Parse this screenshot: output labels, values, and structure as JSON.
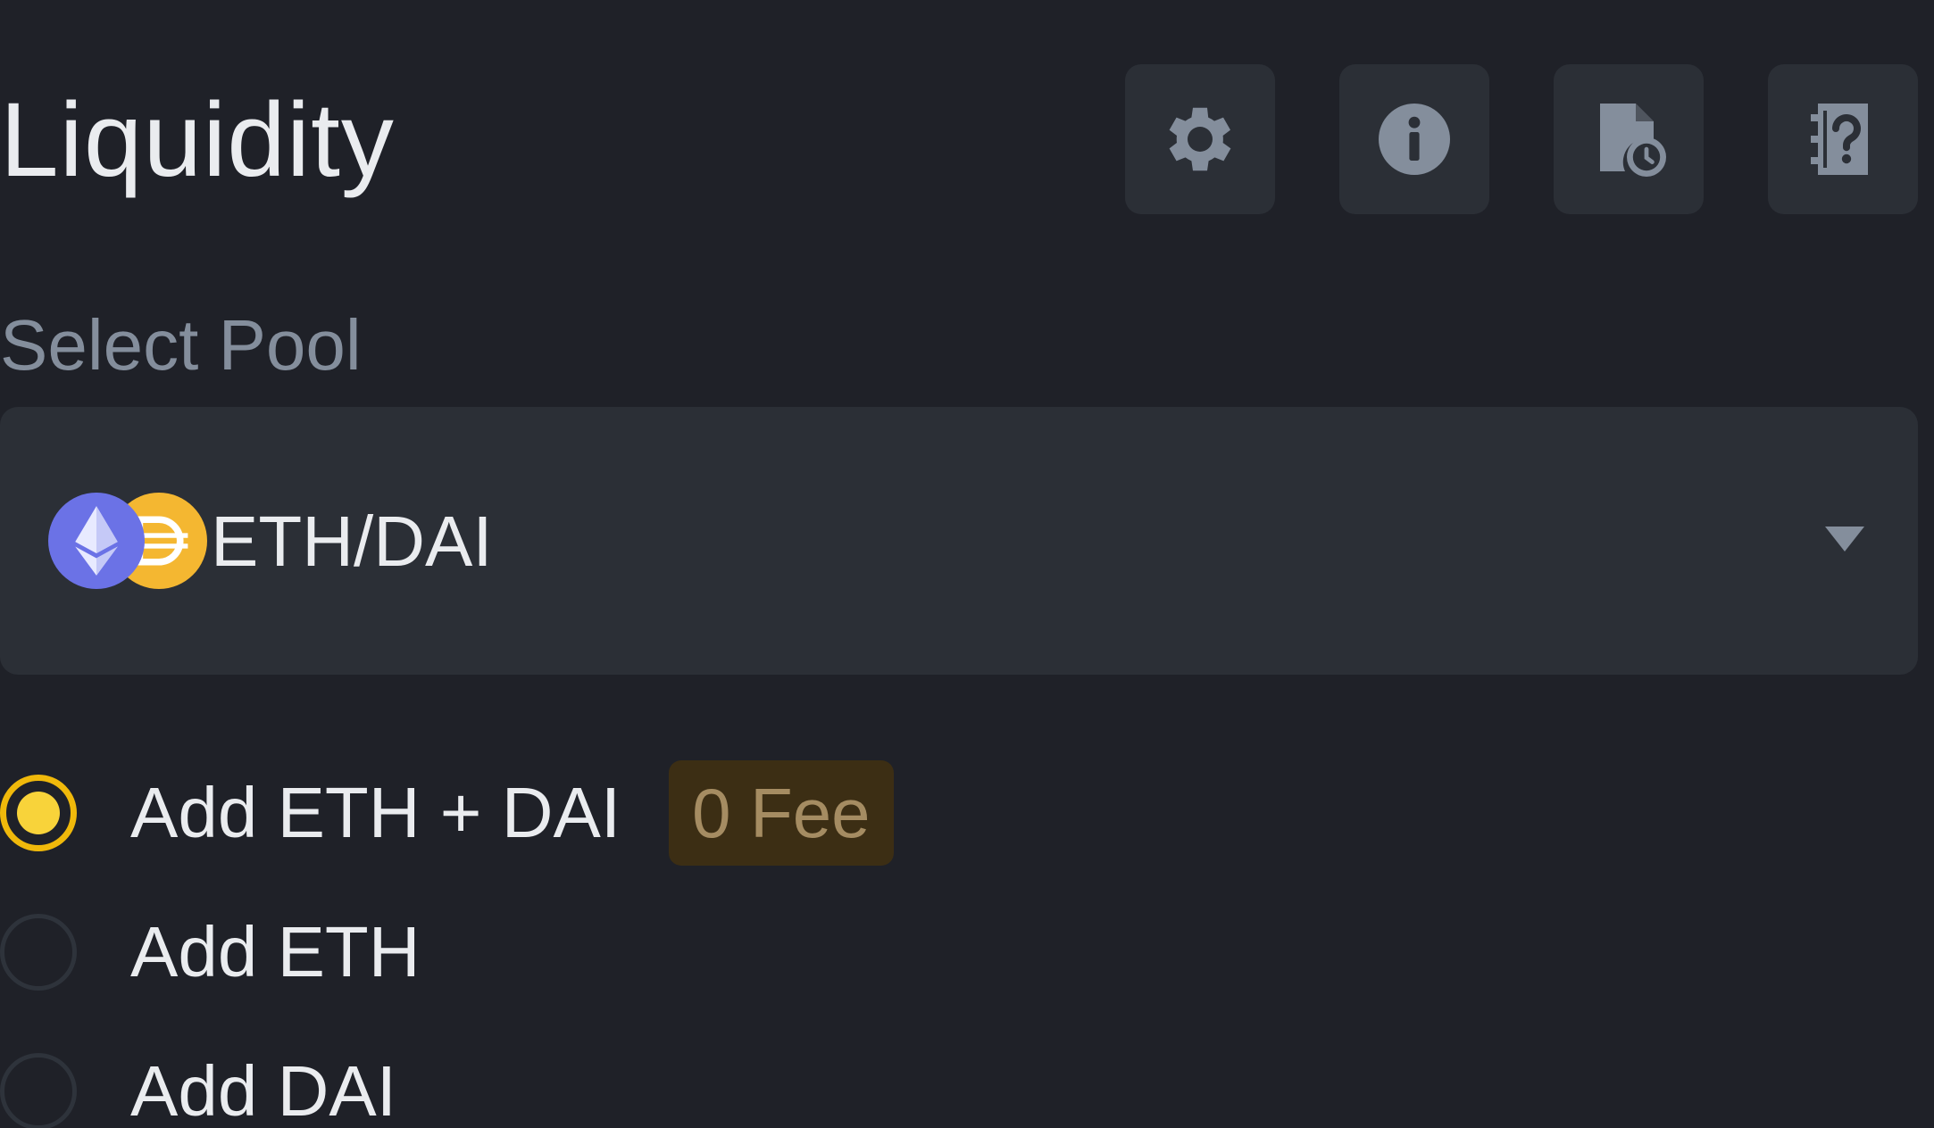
{
  "header": {
    "title": "Liquidity",
    "icons": [
      "gear-icon",
      "info-icon",
      "history-icon",
      "help-icon"
    ]
  },
  "pool": {
    "label": "Select Pool",
    "selected": "ETH/DAI",
    "tokens": [
      "ETH",
      "DAI"
    ]
  },
  "options": [
    {
      "label": "Add ETH + DAI",
      "badge": "0 Fee",
      "checked": true
    },
    {
      "label": "Add ETH",
      "checked": false
    },
    {
      "label": "Add DAI",
      "checked": false
    }
  ],
  "colors": {
    "background": "#1f2128",
    "panel": "#2b2f36",
    "accent": "#f0b90b",
    "eth": "#6b72e6",
    "dai": "#f4b731"
  }
}
